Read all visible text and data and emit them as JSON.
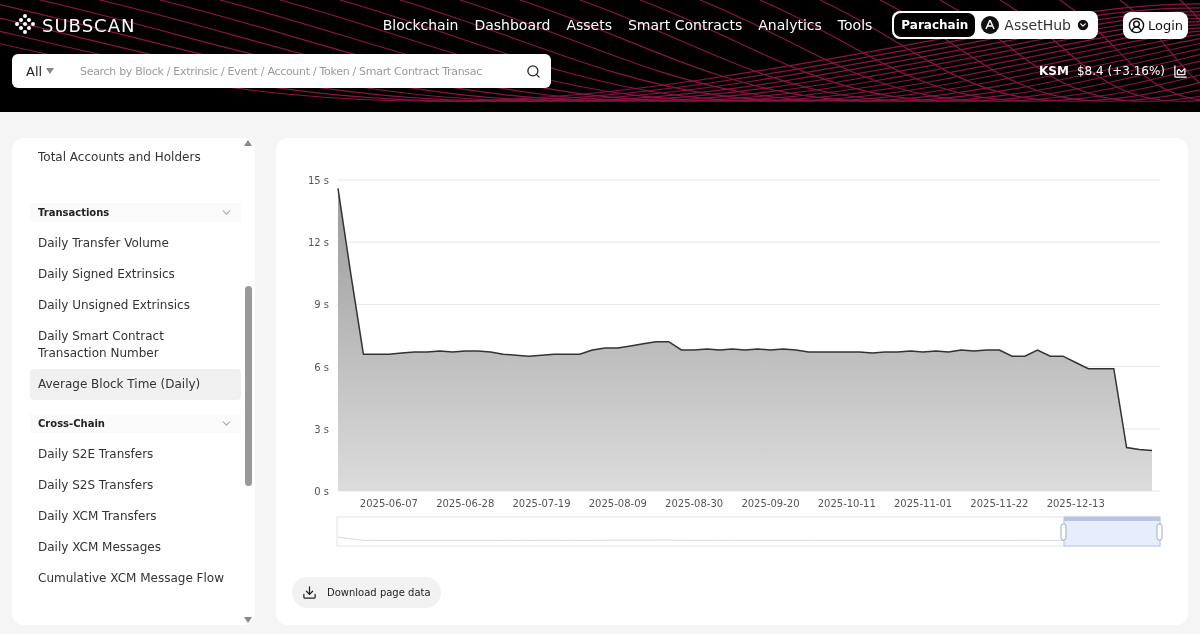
{
  "header": {
    "logo": "SUBSCAN",
    "nav": [
      "Blockchain",
      "Dashboard",
      "Assets",
      "Smart Contracts",
      "Analytics",
      "Tools"
    ],
    "network": {
      "type": "Parachain",
      "name": "AssetHub"
    },
    "login": "Login",
    "search": {
      "filter": "All",
      "placeholder": "Search by Block / Extrinsic / Event / Account / Token / Smart Contract Transac"
    },
    "price": {
      "symbol": "KSM",
      "value": "$8.4 (+3.16%)"
    }
  },
  "sidebar": {
    "items": [
      {
        "kind": "item",
        "label": "Total Accounts and Holders",
        "selected": false
      },
      {
        "kind": "group",
        "label": "Transactions",
        "expanded": true
      },
      {
        "kind": "item",
        "label": "Daily Transfer Volume",
        "selected": false
      },
      {
        "kind": "item",
        "label": "Daily Signed Extrinsics",
        "selected": false
      },
      {
        "kind": "item",
        "label": "Daily Unsigned Extrinsics",
        "selected": false
      },
      {
        "kind": "item",
        "label": "Daily Smart Contract Transaction Number",
        "selected": false
      },
      {
        "kind": "item",
        "label": "Average Block Time (Daily)",
        "selected": true
      },
      {
        "kind": "group",
        "label": "Cross-Chain",
        "expanded": true
      },
      {
        "kind": "item",
        "label": "Daily S2E Transfers",
        "selected": false
      },
      {
        "kind": "item",
        "label": "Daily S2S Transfers",
        "selected": false
      },
      {
        "kind": "item",
        "label": "Daily XCM Transfers",
        "selected": false
      },
      {
        "kind": "item",
        "label": "Daily XCM Messages",
        "selected": false
      },
      {
        "kind": "item",
        "label": "Cumulative XCM Message Flow",
        "selected": false
      }
    ]
  },
  "chart": {
    "chart_data": {
      "type": "area",
      "categories": [
        null,
        null,
        null,
        null,
        "2025-06-07",
        null,
        null,
        null,
        null,
        null,
        "2025-06-28",
        null,
        null,
        null,
        null,
        null,
        "2025-07-19",
        null,
        null,
        null,
        null,
        null,
        "2025-08-09",
        null,
        null,
        null,
        null,
        null,
        "2025-08-30",
        null,
        null,
        null,
        null,
        null,
        "2025-09-20",
        null,
        null,
        null,
        null,
        null,
        "2025-10-11",
        null,
        null,
        null,
        null,
        null,
        "2025-11-01",
        null,
        null,
        null,
        null,
        null,
        "2025-11-22",
        null,
        null,
        null,
        null,
        null,
        "2025-12-13",
        null,
        null,
        null,
        null,
        null,
        null
      ],
      "series": [
        {
          "color": "#333333",
          "values": [
            14.6,
            10.5,
            6.6,
            6.6,
            6.6,
            6.65,
            6.7,
            6.7,
            6.75,
            6.7,
            6.75,
            6.75,
            6.7,
            6.6,
            6.55,
            6.5,
            6.55,
            6.6,
            6.6,
            6.6,
            6.8,
            6.9,
            6.9,
            7.0,
            7.1,
            7.2,
            7.2,
            6.8,
            6.8,
            6.85,
            6.8,
            6.85,
            6.8,
            6.85,
            6.8,
            6.85,
            6.8,
            6.7,
            6.7,
            6.7,
            6.7,
            6.7,
            6.65,
            6.7,
            6.7,
            6.75,
            6.7,
            6.75,
            6.7,
            6.8,
            6.75,
            6.8,
            6.8,
            6.5,
            6.5,
            6.8,
            6.5,
            6.5,
            6.2,
            5.9,
            5.9,
            5.9,
            2.1,
            2.0,
            1.95
          ]
        }
      ],
      "ylim": [
        0,
        15
      ],
      "grid": true,
      "yticks": [
        {
          "value": 0,
          "label": "0 s"
        },
        {
          "value": 3,
          "label": "3 s"
        },
        {
          "value": 6,
          "label": "6 s"
        },
        {
          "value": 9,
          "label": "9 s"
        },
        {
          "value": 12,
          "label": "12 s"
        },
        {
          "value": 15,
          "label": "15 s"
        }
      ]
    },
    "download": "Download page data"
  }
}
